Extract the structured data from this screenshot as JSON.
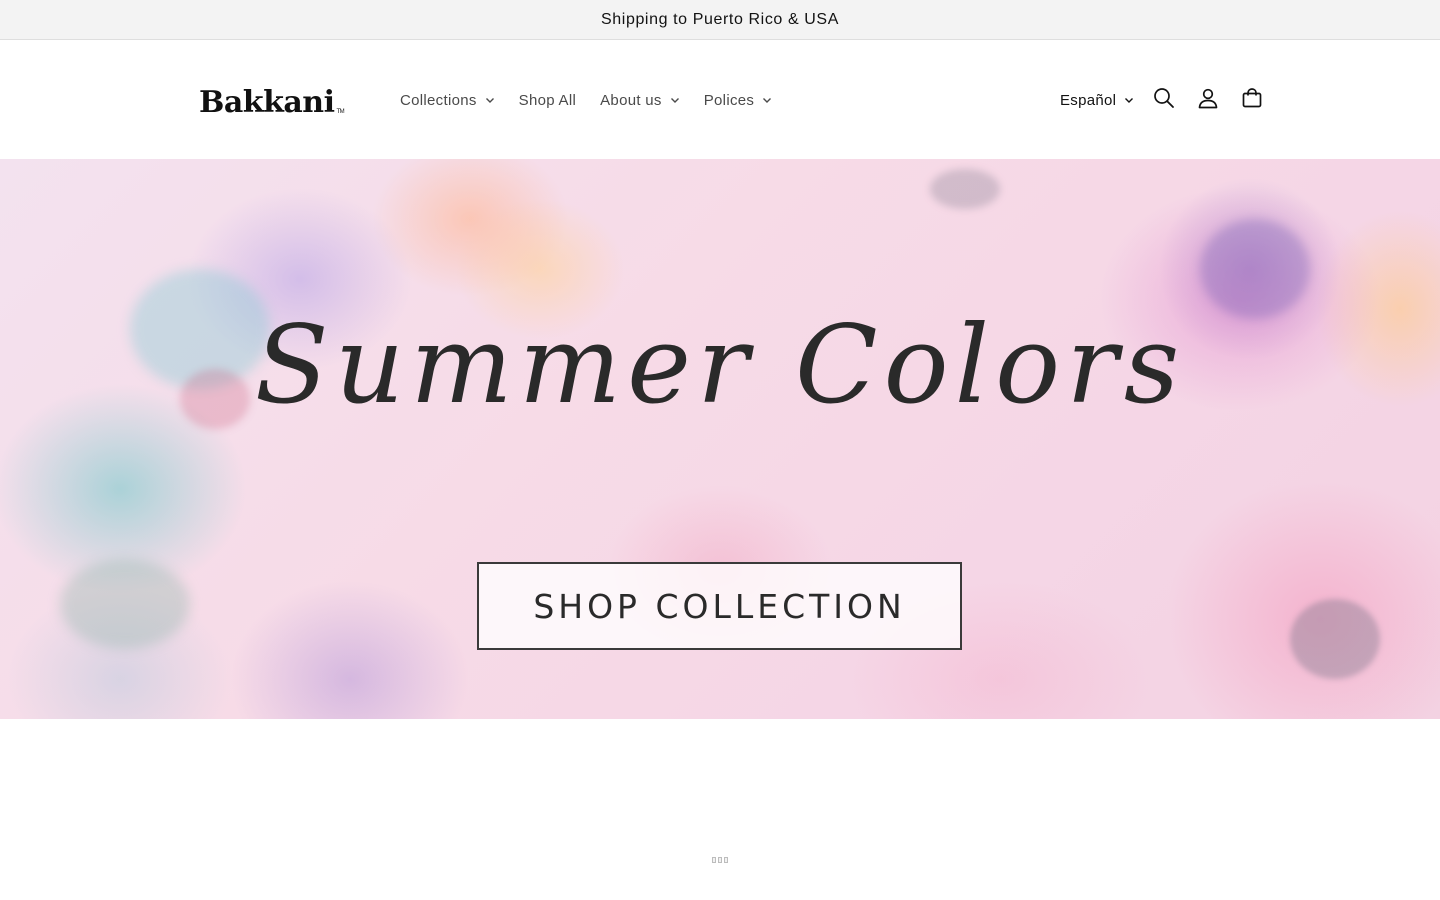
{
  "announcement": {
    "text": "Shipping to Puerto Rico & USA"
  },
  "header": {
    "logo": {
      "text": "Bakkani",
      "trademark": "TM"
    },
    "nav": [
      {
        "label": "Collections",
        "has_dropdown": true
      },
      {
        "label": "Shop All",
        "has_dropdown": false
      },
      {
        "label": "About us",
        "has_dropdown": true
      },
      {
        "label": "Polices",
        "has_dropdown": true
      }
    ],
    "language": {
      "label": "Español",
      "has_dropdown": true
    },
    "icons": [
      "search-icon",
      "account-icon",
      "cart-icon"
    ]
  },
  "hero": {
    "title": "Summer Colors",
    "button_label": "SHOP COLLECTION"
  },
  "colors": {
    "announcement_bg": "#f3f3f3",
    "text": "#121212",
    "nav_text": "#4a4a4a",
    "hero_text": "#2a2a2a"
  }
}
